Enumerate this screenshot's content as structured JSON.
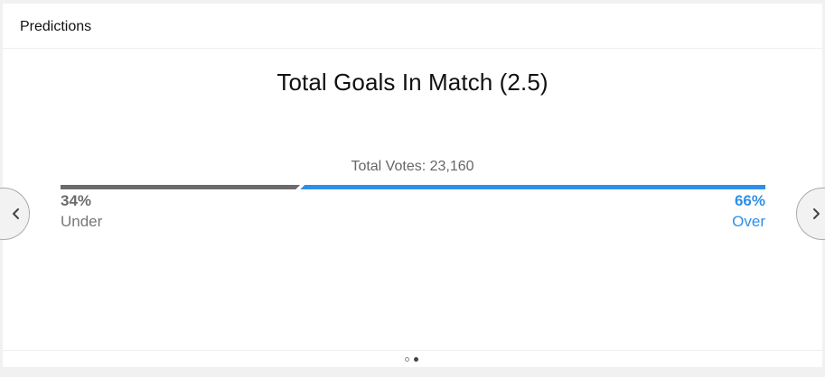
{
  "header": {
    "title": "Predictions"
  },
  "prediction": {
    "title": "Total Goals In Match (2.5)",
    "total_votes_text": "Total Votes: 23,160",
    "under": {
      "percent_text": "34%",
      "label": "Under",
      "share": 0.34,
      "color": "#6b6b6b"
    },
    "over": {
      "percent_text": "66%",
      "label": "Over",
      "share": 0.66,
      "color": "#2f8fe8"
    }
  },
  "navigation": {
    "prev_icon": "chevron-left-icon",
    "next_icon": "chevron-right-icon"
  },
  "pagination": {
    "pages": 2,
    "active_page": 2
  }
}
